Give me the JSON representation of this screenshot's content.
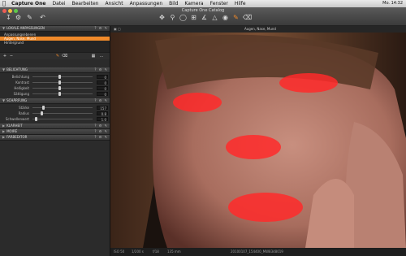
{
  "menubar": {
    "items": [
      "Capture One",
      "Datei",
      "Bearbeiten",
      "Ansicht",
      "Anpassungen",
      "Bild",
      "Kamera",
      "Fenster",
      "Hilfe"
    ],
    "status_right": "Mo. 14:32"
  },
  "window": {
    "title": "Capture One Catalog",
    "colors": {
      "accent": "#f08a2a",
      "panel": "#2b2b2b",
      "mask": "#ff2a2a"
    }
  },
  "toolbar": {
    "left_icons": [
      "import-icon",
      "export-icon",
      "brush-icon",
      "undo-icon",
      "redo-icon"
    ],
    "center_icons": [
      "pan-icon",
      "zoom-icon",
      "loupe-icon",
      "crop-icon",
      "straighten-icon",
      "keystone-icon",
      "spot-removal-icon",
      "white-balance-picker-icon",
      "draw-mask-icon",
      "erase-mask-icon",
      "gradient-mask-icon"
    ]
  },
  "panel": {
    "layers_header": "Lokale Anpassungen",
    "layers": [
      "Anpassungsebenen",
      "Augen, Nase, Mund",
      "Hintergrund"
    ],
    "selected_layer_index": 1,
    "layer_tools": [
      "add-layer-icon",
      "remove-layer-icon",
      "brush-tool-icon",
      "erase-tool-icon"
    ],
    "exposure": {
      "header": "Belichtung",
      "rows": [
        {
          "label": "Belichtung",
          "value": "0",
          "position": 0.45
        },
        {
          "label": "Kontrast",
          "value": "0",
          "position": 0.45
        },
        {
          "label": "Helligkeit",
          "value": "0",
          "position": 0.45
        },
        {
          "label": "Sättigung",
          "value": "0",
          "position": 0.45
        }
      ]
    },
    "sharpening": {
      "header": "Schärfung",
      "rows": [
        {
          "label": "Stärke",
          "value": "157",
          "position": 0.18
        },
        {
          "label": "Radius",
          "value": "0.8",
          "position": 0.15
        },
        {
          "label": "Schwellenwert",
          "value": "1.0",
          "position": 0.05
        }
      ]
    },
    "collapsed_sections": [
      "Klarheit",
      "Moiré",
      "Farbeditor"
    ]
  },
  "viewer": {
    "layer_name": "Augen, Nase, Mund",
    "status": {
      "iso": "ISO 50",
      "shutter": "1/200 s",
      "aperture": "f/18",
      "focal": "135 mm",
      "filename": "20100107_154400_MW8348019"
    }
  }
}
